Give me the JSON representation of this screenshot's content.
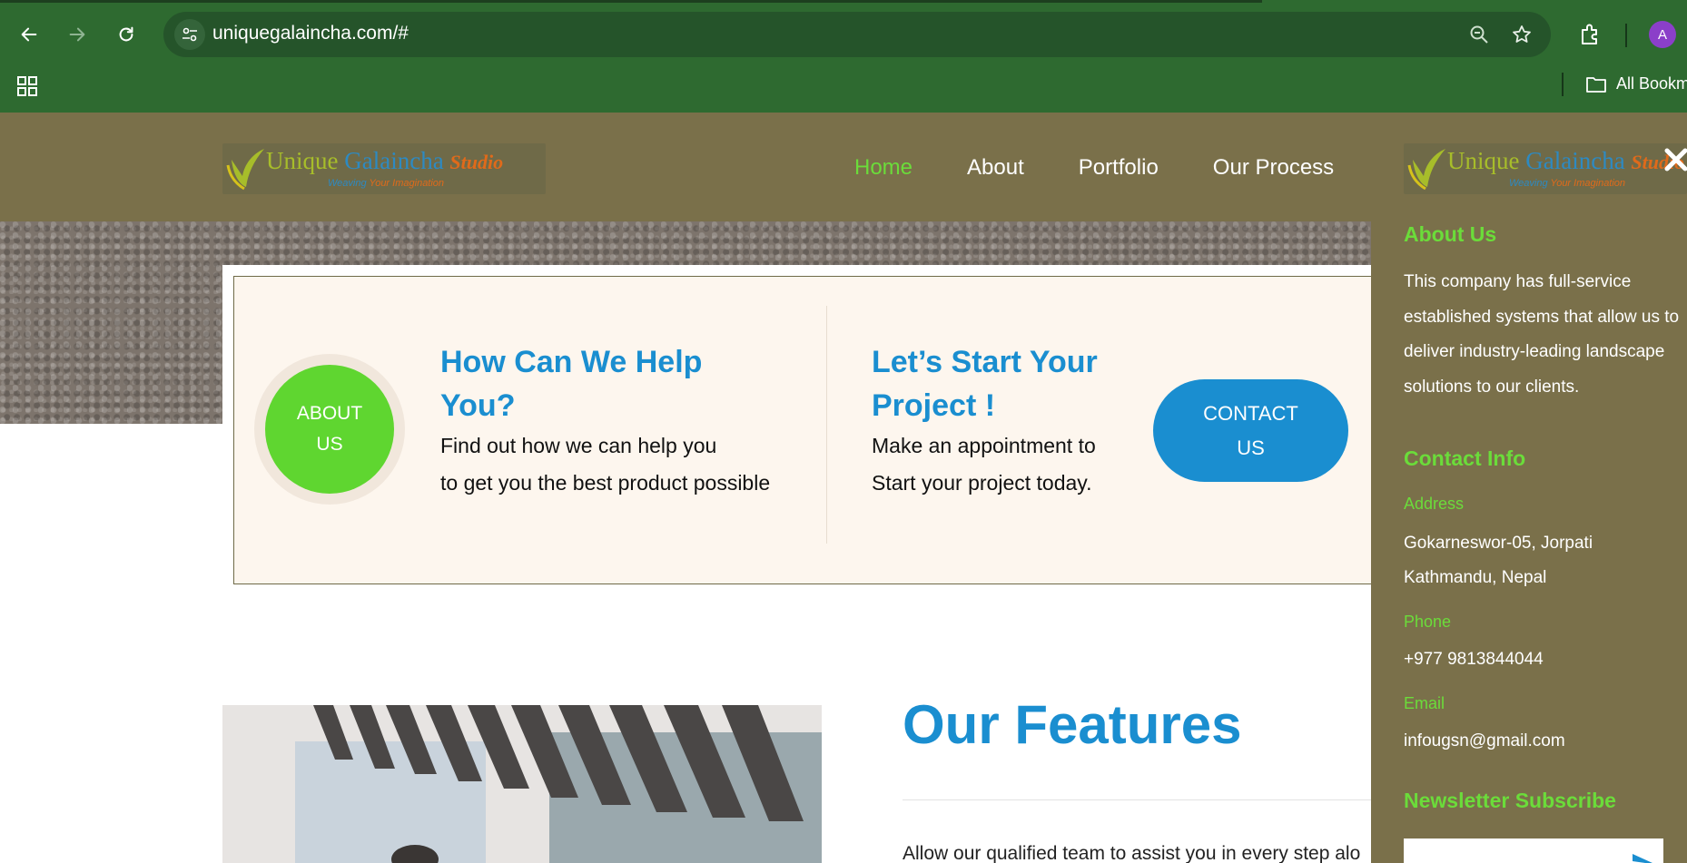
{
  "browser": {
    "url": "uniquegalaincha.com/#",
    "avatar_letter": "A",
    "bookmarks_label": "All Bookm",
    "icons": [
      "back-icon",
      "forward-icon",
      "reload-icon",
      "site-info-icon",
      "zoom-icon",
      "bookmark-star-icon",
      "extensions-icon",
      "apps-icon",
      "folder-icon"
    ]
  },
  "site": {
    "logo": {
      "word1": "Unique",
      "word2": "Galaincha",
      "word3": "Studio",
      "tagline_a": "Weaving",
      "tagline_b": "Your",
      "tagline_c": "Imagination"
    },
    "nav": [
      {
        "label": "Home",
        "active": true
      },
      {
        "label": "About",
        "active": false
      },
      {
        "label": "Portfolio",
        "active": false
      },
      {
        "label": "Our Process",
        "active": false
      }
    ],
    "help": {
      "about_button": "ABOUT US",
      "title1": "How Can We Help You?",
      "text1_line1": "Find out how we can help you",
      "text1_line2": "to get you the best product possible",
      "title2": "Let’s Start Your Project !",
      "text2_line1": "Make an appointment to",
      "text2_line2": "Start your project today.",
      "contact_button": "CONTACT US"
    },
    "features": {
      "title": "Our Features",
      "intro": "Allow our qualified team to assist you in every step alo"
    }
  },
  "side_panel": {
    "about_heading": "About Us",
    "about_text": "This company has full-service established systems that allow us to deliver industry-leading landscape solutions to our clients.",
    "contact_heading": "Contact Info",
    "address_label": "Address",
    "address_line1": "Gokarneswor-05, Jorpati",
    "address_line2": "Kathmandu, Nepal",
    "phone_label": "Phone",
    "phone_value": "+977 9813844044",
    "email_label": "Email",
    "email_value": "infougsn@gmail.com",
    "newsletter_heading": "Newsletter Subscribe"
  },
  "colors": {
    "chrome_green": "#2e6a30",
    "header_olive": "#7a704a",
    "accent_green": "#6bdc3a",
    "accent_blue": "#1a8ed0"
  }
}
